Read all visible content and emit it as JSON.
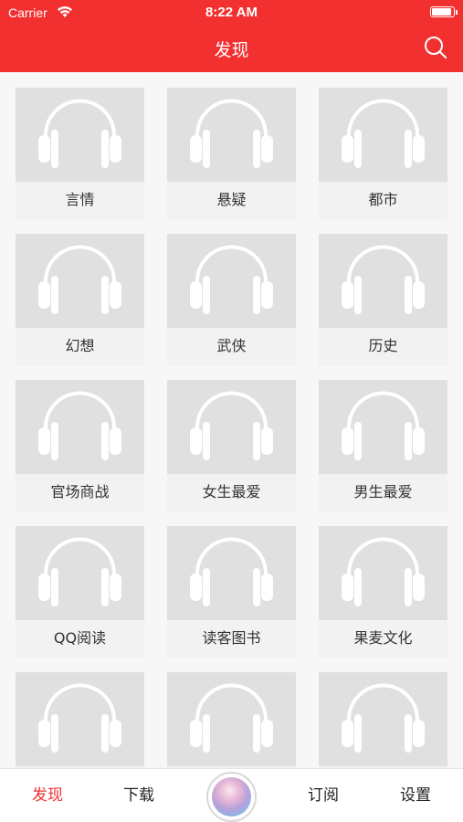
{
  "status_bar": {
    "carrier": "Carrier",
    "time": "8:22 AM"
  },
  "nav": {
    "title": "发现",
    "search_icon": "search-icon"
  },
  "categories": [
    {
      "label": "言情"
    },
    {
      "label": "悬疑"
    },
    {
      "label": "都市"
    },
    {
      "label": "幻想"
    },
    {
      "label": "武侠"
    },
    {
      "label": "历史"
    },
    {
      "label": "官场商战"
    },
    {
      "label": "女生最爱"
    },
    {
      "label": "男生最爱"
    },
    {
      "label": "QQ阅读"
    },
    {
      "label": "读客图书"
    },
    {
      "label": "果麦文化"
    },
    {
      "label": ""
    },
    {
      "label": ""
    },
    {
      "label": ""
    }
  ],
  "tabbar": {
    "discover": "发现",
    "download": "下载",
    "center": "player-avatar",
    "subscribe": "订阅",
    "settings": "设置"
  },
  "colors": {
    "accent": "#f23030",
    "placeholder": "#e0e0e0",
    "icon_fill": "#ffffff"
  }
}
